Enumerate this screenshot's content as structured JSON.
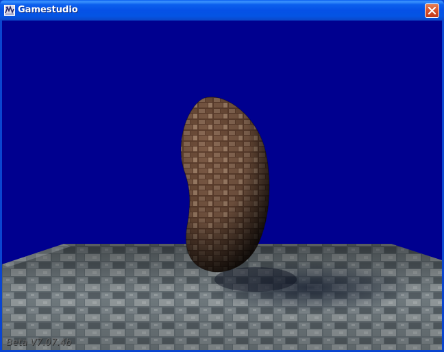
{
  "window": {
    "title": "Gamestudio",
    "icon": "gamestudio-app-icon",
    "close_icon": "close-icon"
  },
  "scene": {
    "background_color": "#00008f",
    "floor_texture": "stone-tile-floor",
    "object": "textured-bean-shaped-blob",
    "version_text": "Beta V7.07.4b"
  }
}
